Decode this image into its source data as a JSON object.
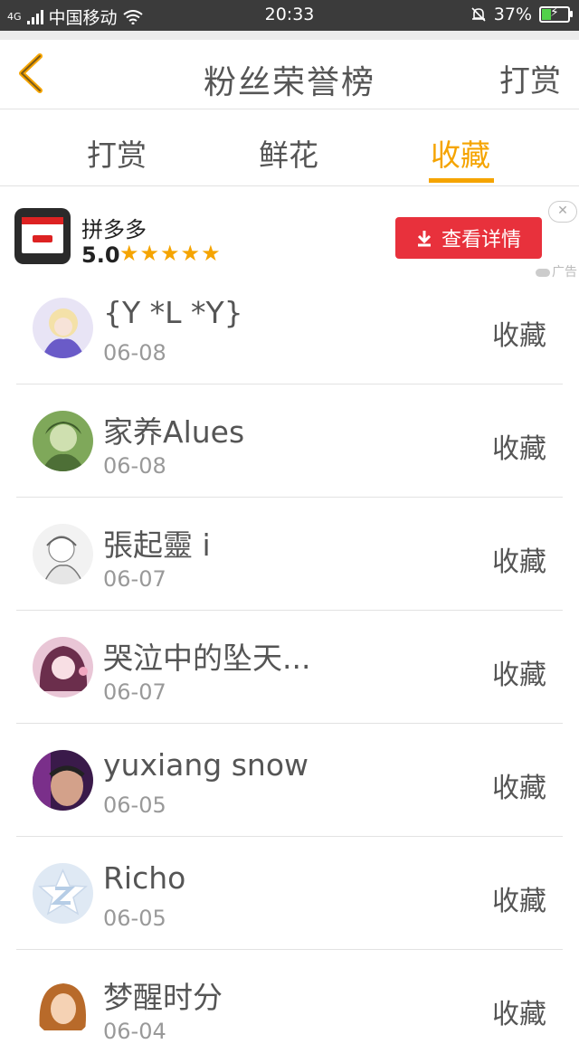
{
  "status_bar": {
    "network": "4G",
    "carrier": "中国移动",
    "time": "20:33",
    "battery": "37%",
    "battery_level": 0.37,
    "icons": [
      "signal-icon",
      "wifi-icon",
      "bell-muted-icon",
      "battery-charging-icon"
    ]
  },
  "header": {
    "title": "粉丝荣誉榜",
    "right_action": "打赏",
    "back_icon": "chevron-left-icon"
  },
  "tabs": [
    {
      "label": "打赏",
      "active": false
    },
    {
      "label": "鲜花",
      "active": false
    },
    {
      "label": "收藏",
      "active": true
    }
  ],
  "ad": {
    "app_name": "拼多多",
    "rating": "5.0",
    "stars": "★★★★★",
    "button_label": "查看详情",
    "close_glyph": "✕",
    "label": "广告"
  },
  "fans": [
    {
      "name": "{Y *L *Y}",
      "date": "06-08",
      "action": "收藏"
    },
    {
      "name": "家养Alues",
      "date": "06-08",
      "action": "收藏"
    },
    {
      "name": "張起靈 i",
      "date": "06-07",
      "action": "收藏"
    },
    {
      "name": "哭泣中的坠天...",
      "date": "06-07",
      "action": "收藏"
    },
    {
      "name": "yuxiang snow",
      "date": "06-05",
      "action": "收藏"
    },
    {
      "name": "Richo",
      "date": "06-05",
      "action": "收藏"
    },
    {
      "name": "梦醒时分",
      "date": "06-04",
      "action": "收藏"
    }
  ],
  "colors": {
    "accent": "#f5a400",
    "ad_button": "#e8313c",
    "status_bar": "#3b3b3b"
  }
}
